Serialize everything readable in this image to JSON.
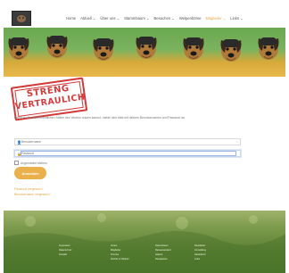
{
  "header": {
    "logo_alt": "",
    "nav": [
      {
        "label": "Home",
        "active": false
      },
      {
        "label": "Aktuell ⌄",
        "active": false
      },
      {
        "label": "Über uns ⌄",
        "active": false
      },
      {
        "label": "Stammbaum ⌄",
        "active": false
      },
      {
        "label": "Besuchen ⌄",
        "active": false
      },
      {
        "label": "Welpenbörse",
        "active": false
      },
      {
        "label": "Mitglieder ⌄",
        "active": true
      },
      {
        "label": "Links ⌄",
        "active": false
      }
    ]
  },
  "main": {
    "stamp": {
      "line1": "STRENG",
      "line2": "VERTRAULICH"
    },
    "intro": "Damit du die nicht-öffentlichen Seiten des Vereins nutzen kannst, melde dich bitte mit deinem Benutzernamen und Passwort an.",
    "username": {
      "placeholder": "Benutzername",
      "value": ""
    },
    "password": {
      "placeholder": "Passwort",
      "value": ""
    },
    "remember_label": "Angemeldet bleiben",
    "login_button": "Anmelden",
    "forgot_password": "Passwort vergessen?",
    "forgot_username": "Benutzername vergessen?"
  },
  "footer": {
    "columns": [
      [
        "Impressum",
        "Datenschutz",
        "Kontakt"
      ],
      [
        "Verein",
        "Mitglieder",
        "Termine",
        "Züchter & Welpen"
      ],
      [
        "Stammbaum",
        "Rassestandard",
        "Galerie",
        "Neuigkeiten"
      ],
      [
        "Newsletter",
        "Anmeldung",
        "Gästebuch",
        "Links"
      ]
    ]
  },
  "colors": {
    "accent": "#e9b04c",
    "stamp_red": "#d23a3a",
    "banner_green": "#6aa84f",
    "grass": "#5f8436"
  }
}
